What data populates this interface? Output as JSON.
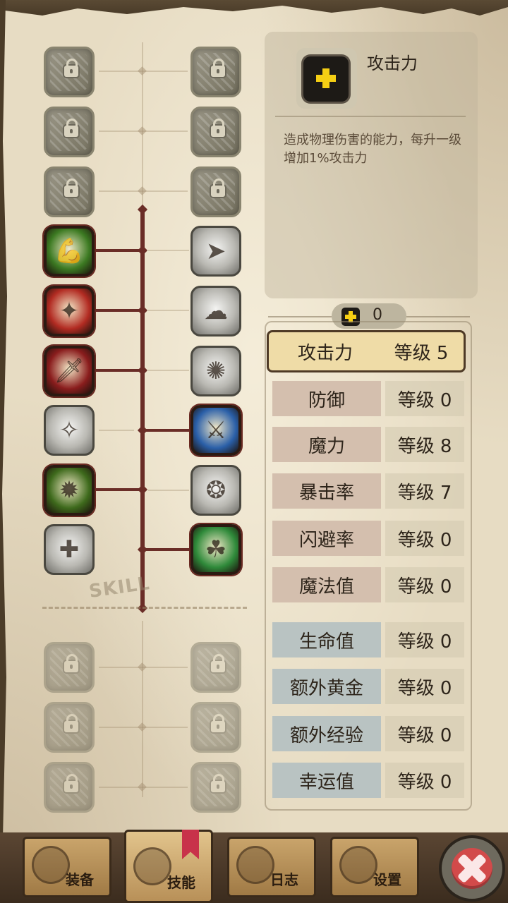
{
  "skill_tree": {
    "watermark": "SKILL",
    "left_column": [
      {
        "state": "locked",
        "icon": "lock-icon"
      },
      {
        "state": "locked",
        "icon": "lock-icon"
      },
      {
        "state": "locked",
        "icon": "lock-icon"
      },
      {
        "state": "learned",
        "icon": "muscle-arm-icon",
        "color": "#3c7a22"
      },
      {
        "state": "learned",
        "icon": "slash-icon",
        "color": "#b22b22"
      },
      {
        "state": "learned",
        "icon": "dagger-icon",
        "color": "#8a1d1d"
      },
      {
        "state": "unlearned",
        "icon": "shadow-dash-icon"
      },
      {
        "state": "learned",
        "icon": "flame-warrior-icon",
        "color": "#3e6a1c"
      },
      {
        "state": "unlearned",
        "icon": "cross-sword-icon"
      }
    ],
    "right_column": [
      {
        "state": "locked",
        "icon": "lock-icon"
      },
      {
        "state": "locked",
        "icon": "lock-icon"
      },
      {
        "state": "locked",
        "icon": "lock-icon"
      },
      {
        "state": "unlearned",
        "icon": "charge-icon"
      },
      {
        "state": "unlearned",
        "icon": "smoke-icon"
      },
      {
        "state": "unlearned",
        "icon": "shield-burst-icon"
      },
      {
        "state": "learned",
        "icon": "ice-sword-icon",
        "color": "#2a5fa8"
      },
      {
        "state": "unlearned",
        "icon": "orb-icon"
      },
      {
        "state": "learned",
        "icon": "clover-spirit-icon",
        "color": "#2f8a3a"
      }
    ],
    "future_left": [
      {
        "state": "locked",
        "icon": "lock-icon"
      },
      {
        "state": "locked",
        "icon": "lock-icon"
      },
      {
        "state": "locked",
        "icon": "lock-icon"
      }
    ],
    "future_right": [
      {
        "state": "locked",
        "icon": "lock-icon"
      },
      {
        "state": "locked",
        "icon": "lock-icon"
      },
      {
        "state": "locked",
        "icon": "lock-icon"
      }
    ]
  },
  "info": {
    "title": "攻击力",
    "icon": "plus-icon",
    "description": "造成物理伤害的能力，每升一级增加1%攻击力"
  },
  "points": {
    "icon": "plus-icon",
    "value": "0"
  },
  "stats": [
    {
      "name": "攻击力",
      "level": "等级 5",
      "group": "red",
      "selected": true
    },
    {
      "name": "防御",
      "level": "等级 0",
      "group": "red"
    },
    {
      "name": "魔力",
      "level": "等级 8",
      "group": "red"
    },
    {
      "name": "暴击率",
      "level": "等级 7",
      "group": "red"
    },
    {
      "name": "闪避率",
      "level": "等级 0",
      "group": "red"
    },
    {
      "name": "魔法值",
      "level": "等级 0",
      "group": "red"
    },
    {
      "name": "生命值",
      "level": "等级 0",
      "group": "blue"
    },
    {
      "name": "额外黄金",
      "level": "等级 0",
      "group": "blue"
    },
    {
      "name": "额外经验",
      "level": "等级 0",
      "group": "blue"
    },
    {
      "name": "幸运值",
      "level": "等级 0",
      "group": "blue"
    }
  ],
  "tabs": [
    {
      "label": "装备",
      "icon": "axe-icon"
    },
    {
      "label": "技能",
      "icon": "skill-emblem-icon",
      "active": true
    },
    {
      "label": "日志",
      "icon": "journal-icon"
    },
    {
      "label": "设置",
      "icon": "gear-icon"
    }
  ],
  "close": {
    "icon": "close-icon",
    "color": "#d24a4a"
  }
}
